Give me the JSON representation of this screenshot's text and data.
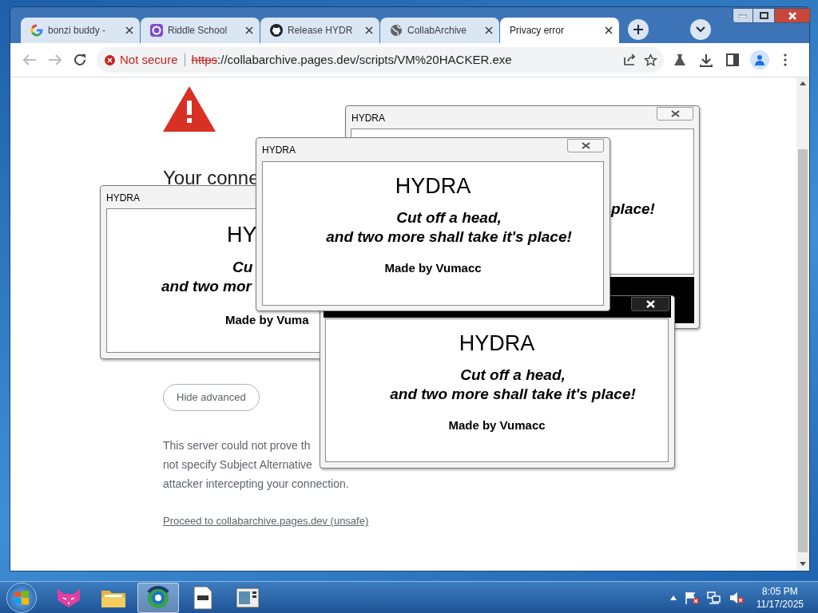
{
  "browser": {
    "tabs": [
      {
        "title": "bonzi buddy -",
        "kind": "google",
        "selected": false
      },
      {
        "title": "Riddle School",
        "kind": "app",
        "selected": false
      },
      {
        "title": "Release HYDR",
        "kind": "github",
        "selected": false
      },
      {
        "title": "CollabArchive",
        "kind": "globe",
        "selected": false
      },
      {
        "title": "Privacy error",
        "kind": "none",
        "selected": true
      }
    ],
    "address": {
      "security": "Not secure",
      "scheme": "https",
      "rest": "://collabarchive.pages.dev/scripts/VM%20HACKER.exe"
    },
    "page": {
      "heading": "Your conne",
      "button": "Hide advanced",
      "paragraph": [
        "This server could not prove th",
        "not specify Subject Alternative",
        "attacker intercepting your connection."
      ],
      "link": "Proceed to collabarchive.pages.dev (unsafe)"
    }
  },
  "popups": [
    {
      "kind": "normal",
      "title": "HYDRA",
      "texts": [
        {
          "kind": "line",
          "text": "place!"
        }
      ]
    },
    {
      "kind": "normal",
      "title": "HYDRA",
      "texts": [
        {
          "kind": "heading",
          "text": "HY"
        },
        {
          "kind": "line",
          "text": "Cu"
        },
        {
          "kind": "line",
          "text": "and two mor"
        },
        {
          "kind": "credit",
          "text": "Made by Vuma"
        }
      ]
    },
    {
      "kind": "dark",
      "texts": [
        {
          "kind": "heading",
          "text": "HYDRA"
        },
        {
          "kind": "line",
          "text": "Cut off a head,"
        },
        {
          "kind": "line",
          "text": "and two more shall take it's place!"
        },
        {
          "kind": "credit",
          "text": "Made by Vumacc"
        }
      ]
    },
    {
      "kind": "normal",
      "title": "HYDRA",
      "texts": [
        {
          "kind": "heading",
          "text": "HYDRA"
        },
        {
          "kind": "line",
          "text": "Cut off a head,"
        },
        {
          "kind": "line",
          "text": "and two more shall take it's place!"
        },
        {
          "kind": "credit",
          "text": "Made by Vumacc"
        }
      ]
    }
  ],
  "taskbar": {
    "items": [
      {
        "kind": "cat",
        "selected": false
      },
      {
        "kind": "folder",
        "selected": false
      },
      {
        "kind": "browser",
        "selected": true
      },
      {
        "kind": "document",
        "selected": false
      },
      {
        "kind": "window",
        "selected": false
      }
    ],
    "time": "8:05 PM",
    "date": "11/17/2025"
  }
}
